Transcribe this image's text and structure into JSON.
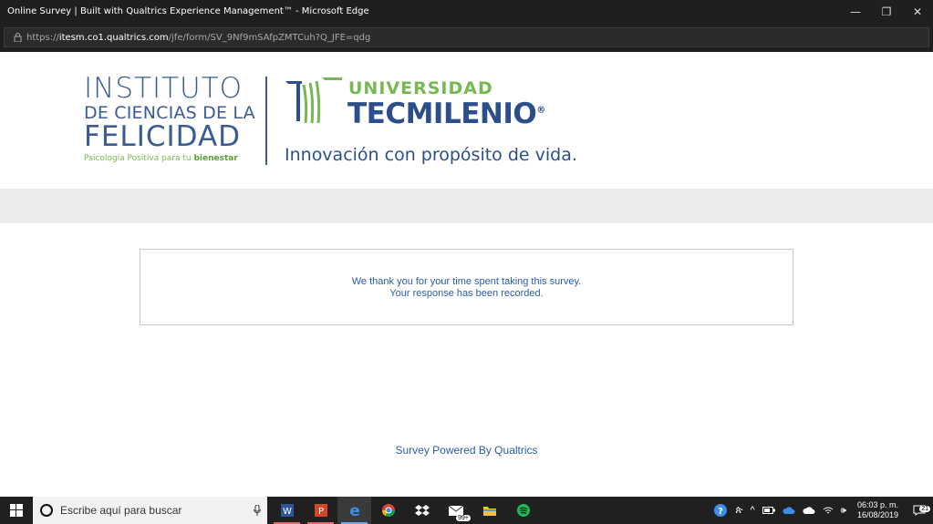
{
  "window": {
    "title": "Online Survey | Built with Qualtrics Experience Management™ - Microsoft Edge",
    "minimize": "—",
    "restore": "❐",
    "close": "✕"
  },
  "address": {
    "scheme": "https://",
    "host": "itesm.co1.qualtrics.com",
    "path": "/jfe/form/SV_9Nf9mSAfpZMTCuh?Q_JFE=qdg"
  },
  "logos": {
    "left": {
      "line1": "INSTITUTO",
      "line2": "DE CIENCIAS DE LA",
      "line3": "FELICIDAD",
      "tagline_prefix": "Psicología Positiva para tu ",
      "tagline_bold": "bienestar"
    },
    "right": {
      "line1": "UNIVERSIDAD",
      "line2": "TECMILENIO",
      "slogan": "Innovación con propósito de vida."
    }
  },
  "survey": {
    "thanks_line1": "We thank you for your time spent taking this survey.",
    "thanks_line2": "Your response has been recorded.",
    "powered_by": "Survey Powered By Qualtrics"
  },
  "taskbar": {
    "search_placeholder": "Escribe aquí para buscar",
    "mail_badge": "99+",
    "clock_time": "06:03 p. m.",
    "clock_date": "16/08/2019",
    "notifications": "21"
  },
  "colors": {
    "brand_blue": "#2c4f8c",
    "brand_green": "#76b852",
    "link_blue": "#2a5da8"
  }
}
